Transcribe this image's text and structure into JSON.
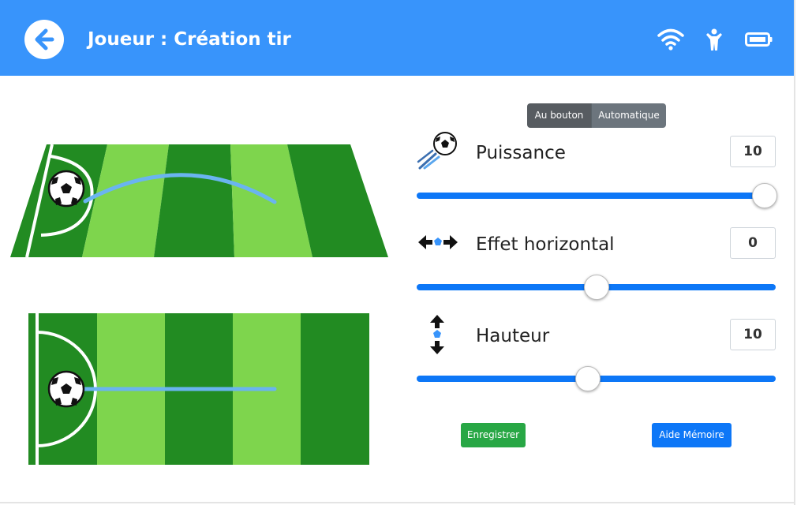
{
  "header": {
    "title": "Joueur : Création tir",
    "background_color": "#3894fb",
    "icons": [
      "back-arrow-icon",
      "wifi-icon",
      "player-icon",
      "battery-icon"
    ]
  },
  "mode": {
    "options": [
      "Au bouton",
      "Automatique"
    ],
    "selected": "Au bouton"
  },
  "controls": {
    "power": {
      "label": "Puissance",
      "value": "10",
      "level": 1.0,
      "icon": "ball-kick-icon"
    },
    "horizontal": {
      "label": "Effet horizontal",
      "value": "0",
      "level": 0.5,
      "icon": "horizontal-arrows-icon"
    },
    "height": {
      "label": "Hauteur",
      "value": "10",
      "level": 0.475,
      "icon": "vertical-arrows-icon"
    }
  },
  "actions": {
    "save_label": "Enregistrer",
    "help_label": "Aide Mémoire"
  },
  "colors": {
    "accent": "#0d77f7",
    "field_dark": "#228b22",
    "field_light": "#7ed54d",
    "trajectory": "#6ab4f0",
    "save_button": "#28a745"
  }
}
